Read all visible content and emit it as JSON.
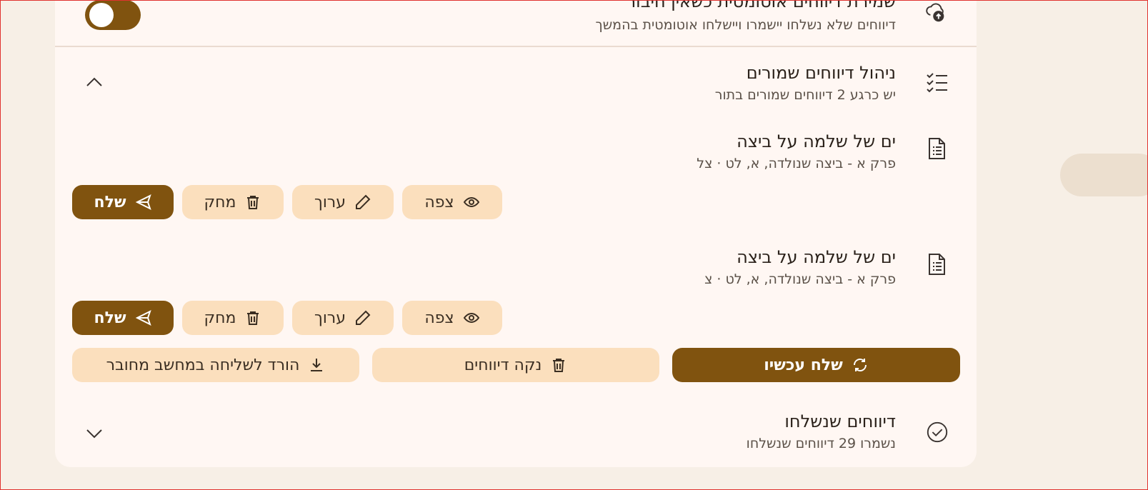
{
  "autosave": {
    "title": "שמירת דיווחים אוטומטית כשאין חיבור",
    "subtitle": "דיווחים שלא נשלחו יישמרו ויישלחו אוטומטית בהמשך",
    "toggle_on": true
  },
  "saved_reports": {
    "title": "ניהול דיווחים שמורים",
    "subtitle": "יש כרגע 2 דיווחים שמורים בתור",
    "items": [
      {
        "title": "ים של שלמה על ביצה",
        "subtitle": "פרק א - ביצה שנולדה, א, לט · צל",
        "actions": {
          "view": "צפה",
          "edit": "ערוך",
          "delete": "מחק",
          "send": "שלח"
        }
      },
      {
        "title": "ים של שלמה על ביצה",
        "subtitle": "פרק א - ביצה שנולדה, א, לט · צ",
        "actions": {
          "view": "צפה",
          "edit": "ערוך",
          "delete": "מחק",
          "send": "שלח"
        }
      }
    ],
    "bulk": {
      "send_now": "שלח עכשיו",
      "clear": "נקה דיווחים",
      "download": "הורד לשליחה במחשב מחובר"
    }
  },
  "sent_reports": {
    "title": "דיווחים שנשלחו",
    "subtitle": "נשמרו 29 דיווחים שנשלחו"
  },
  "colors": {
    "accent": "#80530f",
    "button_light": "#fbdfbd",
    "card": "#fff7f3",
    "page": "#f7efe6"
  }
}
